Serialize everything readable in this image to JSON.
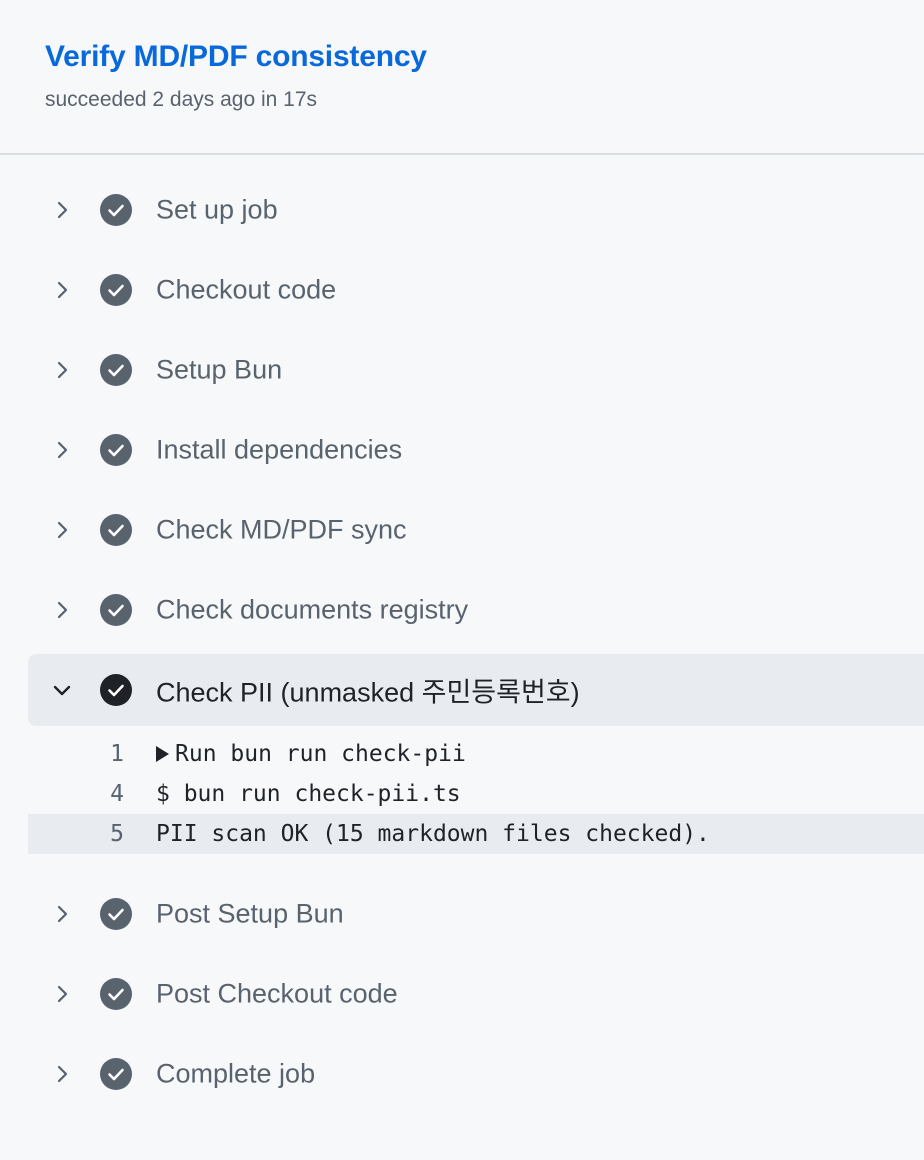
{
  "job": {
    "title": "Verify MD/PDF consistency",
    "meta": "succeeded 2 days ago in 17s"
  },
  "steps_before": [
    {
      "label": "Set up job",
      "status": "success"
    },
    {
      "label": "Checkout code",
      "status": "success"
    },
    {
      "label": "Setup Bun",
      "status": "success"
    },
    {
      "label": "Install dependencies",
      "status": "success"
    },
    {
      "label": "Check MD/PDF sync",
      "status": "success"
    },
    {
      "label": "Check documents registry",
      "status": "success"
    }
  ],
  "expanded_step": {
    "label": "Check PII (unmasked 주민등록번호)",
    "status": "success",
    "log": [
      {
        "num": "1",
        "text": "Run bun run check-pii",
        "collapsible": true
      },
      {
        "num": "4",
        "text": "$ bun run check-pii.ts"
      },
      {
        "num": "5",
        "text": "PII scan OK (15 markdown files checked)."
      }
    ]
  },
  "steps_after": [
    {
      "label": "Post Setup Bun",
      "status": "success"
    },
    {
      "label": "Post Checkout code",
      "status": "success"
    },
    {
      "label": "Complete job",
      "status": "success"
    }
  ],
  "colors": {
    "accent": "#0969da",
    "success_icon": "#59636e",
    "expanded_icon": "#1f2328",
    "background": "#f6f8fa"
  }
}
